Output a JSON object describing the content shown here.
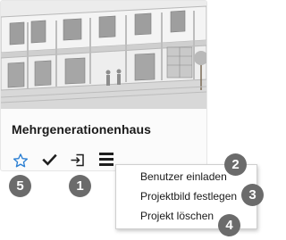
{
  "project": {
    "title": "Mehrgenerationenhaus"
  },
  "actions": {
    "favorite_icon": "star-outline-icon",
    "check_icon": "checkmark-icon",
    "open_icon": "enter-icon",
    "menu_icon": "hamburger-menu-icon"
  },
  "menu": {
    "items": [
      {
        "label": "Benutzer einladen"
      },
      {
        "label": "Projektbild festlegen"
      },
      {
        "label": "Projekt löschen"
      }
    ]
  },
  "markers": [
    "1",
    "2",
    "3",
    "4",
    "5"
  ],
  "colors": {
    "star": "#2b7fd3",
    "marker_bg": "#6b6b6b",
    "title": "#1a1a1a"
  }
}
